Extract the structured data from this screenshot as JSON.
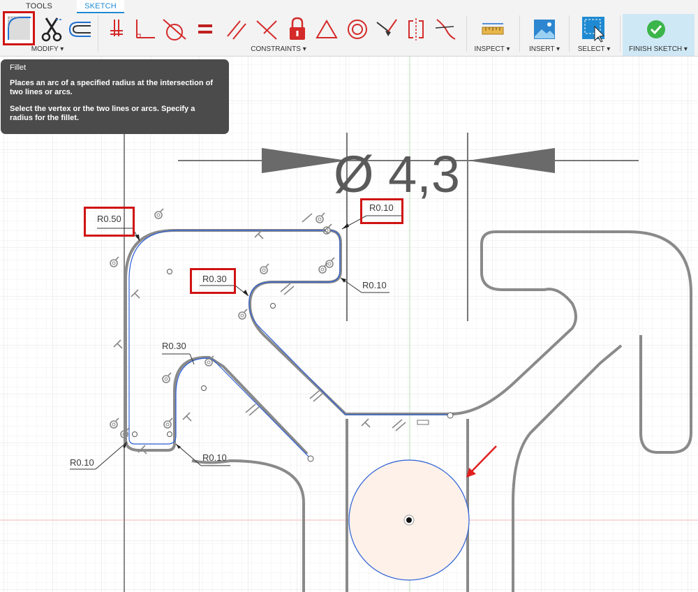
{
  "toolbar": {
    "tabs": [
      {
        "label": "TOOLS",
        "active": false
      },
      {
        "label": "SKETCH",
        "active": true
      }
    ],
    "groups": [
      {
        "label": "MODIFY ▾"
      },
      {
        "label": "CONSTRAINTS ▾"
      },
      {
        "label": "INSPECT ▾"
      },
      {
        "label": "INSERT ▾"
      },
      {
        "label": "SELECT ▾"
      },
      {
        "label": "FINISH SKETCH ▾"
      }
    ],
    "modify_icons": [
      "fillet-icon",
      "trim-icon",
      "offset-icon"
    ],
    "constraint_icons": [
      "coincident-icon",
      "perpendicular-icon",
      "tangent-icon",
      "equal-icon",
      "parallel-icon",
      "perpendicular-cross-icon",
      "fix-lock-icon",
      "triangle-icon",
      "concentric-icon",
      "midpoint-icon",
      "symmetry-icon",
      "smooth-icon"
    ],
    "colors": {
      "accent": "#1f8ad1",
      "highlight_box": "#d01313",
      "finish_check": "#3bb54a",
      "constraint_red": "#d42a2a"
    }
  },
  "tooltip": {
    "title": "Fillet",
    "line1": "Places an arc of a specified radius at the intersection of two lines or arcs.",
    "line2": "Select the vertex or the two lines or arcs. Specify a radius for the fillet."
  },
  "canvas": {
    "dimension_diameter": "Ø 4,3",
    "radius_labels": [
      {
        "id": "r050",
        "text": "R0.50",
        "highlighted": true
      },
      {
        "id": "r010_top",
        "text": "R0.10",
        "highlighted": true
      },
      {
        "id": "r030_inner",
        "text": "R0.30",
        "highlighted": true
      },
      {
        "id": "r010_right",
        "text": "R0.10",
        "highlighted": false
      },
      {
        "id": "r030_lower",
        "text": "R0.30",
        "highlighted": false
      },
      {
        "id": "r010_bl",
        "text": "R0.10",
        "highlighted": false
      },
      {
        "id": "r010_bm",
        "text": "R0.10",
        "highlighted": false
      }
    ],
    "colors": {
      "sketch_line": "#2b5fd6",
      "circle_fill": "#fdf1ea",
      "arrow": "#e02020",
      "grid": "#ececec"
    }
  }
}
